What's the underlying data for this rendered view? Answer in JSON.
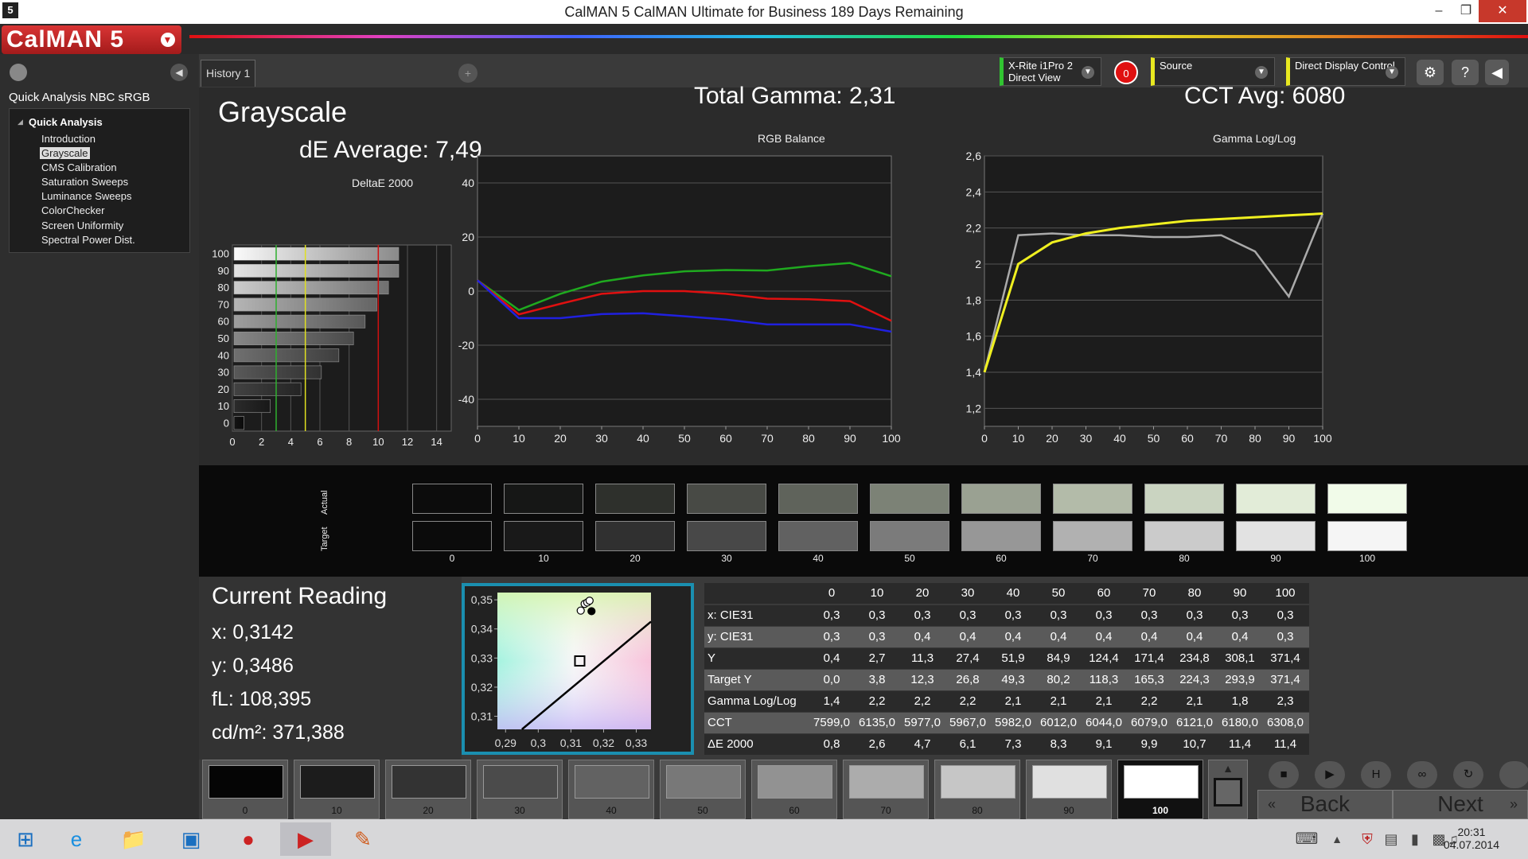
{
  "window": {
    "title": "CalMAN 5 CalMAN Ultimate for Business 189 Days Remaining",
    "app_icon": "5"
  },
  "header": {
    "logo": "CalMAN 5"
  },
  "sidebar": {
    "workflow_title": "Quick Analysis NBC sRGB",
    "root": "Quick Analysis",
    "items": [
      {
        "label": "Introduction"
      },
      {
        "label": "Grayscale",
        "selected": true
      },
      {
        "label": "CMS Calibration"
      },
      {
        "label": "Saturation Sweeps"
      },
      {
        "label": "Luminance Sweeps"
      },
      {
        "label": "ColorChecker"
      },
      {
        "label": "Screen Uniformity"
      },
      {
        "label": "Spectral Power Dist."
      }
    ]
  },
  "tabs": [
    {
      "label": "History 1"
    }
  ],
  "devices": {
    "meter_line1": "X-Rite i1Pro 2",
    "meter_line2": "Direct View",
    "meter_count": "0",
    "source": "Source",
    "display": "Direct Display Control"
  },
  "main": {
    "page_title": "Grayscale",
    "de_average": "dE Average: 7,49",
    "total_gamma": "Total Gamma: 2,31",
    "cct_avg": "CCT Avg: 6080"
  },
  "colors": {
    "accent_red": "#e01010",
    "cie_frame": "#1a8fb0"
  },
  "chart_data": [
    {
      "type": "bar",
      "title": "DeltaE 2000",
      "categories": [
        "100",
        "90",
        "80",
        "70",
        "60",
        "50",
        "40",
        "30",
        "20",
        "10",
        "0"
      ],
      "values": [
        11.4,
        11.4,
        10.7,
        9.9,
        9.1,
        8.3,
        7.3,
        6.1,
        4.7,
        2.6,
        0.8
      ],
      "xlim": [
        0,
        15
      ],
      "x_ticks": [
        "0",
        "2",
        "4",
        "6",
        "8",
        "10",
        "12",
        "14"
      ],
      "threshold_lines": [
        {
          "x": 3,
          "color": "#2fb02f"
        },
        {
          "x": 5,
          "color": "#e0e020"
        },
        {
          "x": 10,
          "color": "#d01010"
        }
      ]
    },
    {
      "type": "line",
      "title": "RGB Balance",
      "x": [
        0,
        10,
        20,
        30,
        40,
        50,
        60,
        70,
        80,
        90,
        100
      ],
      "x_ticks": [
        "0",
        "10",
        "20",
        "30",
        "40",
        "50",
        "60",
        "70",
        "80",
        "90",
        "100"
      ],
      "y_ticks": [
        "40",
        "20",
        "0",
        "-20",
        "-40"
      ],
      "ylim": [
        -50,
        50
      ],
      "series": [
        {
          "color": "#1faa1f",
          "values": [
            4,
            -7,
            -1,
            3.5,
            5.8,
            7.3,
            7.8,
            7.6,
            9.2,
            10.4,
            5.5
          ]
        },
        {
          "color": "#e01010",
          "values": [
            4,
            -8.6,
            -4.7,
            -1,
            0,
            0,
            -1,
            -2.8,
            -3,
            -3.7,
            -11
          ]
        },
        {
          "color": "#2020e0",
          "values": [
            4,
            -10,
            -10,
            -8.5,
            -8.2,
            -9.3,
            -10.5,
            -12.3,
            -12.3,
            -12.3,
            -15
          ]
        }
      ]
    },
    {
      "type": "line",
      "title": "Gamma Log/Log",
      "x": [
        0,
        10,
        20,
        30,
        40,
        50,
        60,
        70,
        80,
        90,
        100
      ],
      "x_ticks": [
        "0",
        "10",
        "20",
        "30",
        "40",
        "50",
        "60",
        "70",
        "80",
        "90",
        "100"
      ],
      "y_ticks": [
        "2,6",
        "2,4",
        "2,2",
        "2",
        "1,8",
        "1,6",
        "1,4",
        "1,2"
      ],
      "ylim": [
        1.1,
        2.6
      ],
      "series": [
        {
          "color": "#aaaaaa",
          "values": [
            1.4,
            2.16,
            2.17,
            2.16,
            2.16,
            2.15,
            2.15,
            2.16,
            2.07,
            1.82,
            2.28
          ]
        },
        {
          "color": "#f0f020",
          "values": [
            1.4,
            2.0,
            2.12,
            2.17,
            2.2,
            2.22,
            2.24,
            2.25,
            2.26,
            2.27,
            2.28
          ]
        }
      ]
    },
    {
      "type": "scatter",
      "title": "",
      "x_ticks": [
        "0,29",
        "0,3",
        "0,31",
        "0,32",
        "0,33"
      ],
      "y_ticks": [
        "0,35",
        "0,34",
        "0,33",
        "0,32",
        "0,31"
      ],
      "xlim": [
        0.2875,
        0.3345
      ],
      "ylim": [
        0.3055,
        0.3525
      ],
      "target_point": {
        "x": 0.3127,
        "y": 0.329
      },
      "points": [
        {
          "x": 0.3142,
          "y": 0.3486,
          "style": "hollow"
        },
        {
          "x": 0.315,
          "y": 0.3491,
          "style": "hollow"
        },
        {
          "x": 0.3157,
          "y": 0.3497,
          "style": "hollow"
        },
        {
          "x": 0.313,
          "y": 0.3463,
          "style": "hollow"
        },
        {
          "x": 0.3163,
          "y": 0.3461,
          "style": "filled"
        }
      ],
      "locus": [
        [
          0.295,
          0.3055
        ],
        [
          0.3345,
          0.3425
        ]
      ]
    }
  ],
  "swatches": {
    "row_actual": "Actual",
    "row_target": "Target",
    "labels": [
      "0",
      "10",
      "20",
      "30",
      "40",
      "50",
      "60",
      "70",
      "80",
      "90",
      "100"
    ],
    "actual": [
      "#0c0c0c",
      "#161716",
      "#2e302c",
      "#484a45",
      "#5f635b",
      "#7c8276",
      "#9aa192",
      "#b3bba9",
      "#cad4c1",
      "#e2ecd8",
      "#f1fbe9"
    ],
    "target": [
      "#0b0b0b",
      "#191919",
      "#303030",
      "#484848",
      "#616161",
      "#7b7b7b",
      "#979797",
      "#b1b1b1",
      "#cbcbcb",
      "#e2e2e2",
      "#f5f5f5"
    ]
  },
  "reading": {
    "title": "Current Reading",
    "x": "x: 0,3142",
    "y": "y: 0,3486",
    "fl": "fL: 108,395",
    "cdm2": "cd/m²: 371,388"
  },
  "table": {
    "columns": [
      "0",
      "10",
      "20",
      "30",
      "40",
      "50",
      "60",
      "70",
      "80",
      "90",
      "100"
    ],
    "rows": [
      {
        "label": "x: CIE31",
        "values": [
          "0,3",
          "0,3",
          "0,3",
          "0,3",
          "0,3",
          "0,3",
          "0,3",
          "0,3",
          "0,3",
          "0,3",
          "0,3"
        ]
      },
      {
        "label": "y: CIE31",
        "values": [
          "0,3",
          "0,3",
          "0,4",
          "0,4",
          "0,4",
          "0,4",
          "0,4",
          "0,4",
          "0,4",
          "0,4",
          "0,3"
        ]
      },
      {
        "label": "Y",
        "values": [
          "0,4",
          "2,7",
          "11,3",
          "27,4",
          "51,9",
          "84,9",
          "124,4",
          "171,4",
          "234,8",
          "308,1",
          "371,4"
        ]
      },
      {
        "label": "Target Y",
        "values": [
          "0,0",
          "3,8",
          "12,3",
          "26,8",
          "49,3",
          "80,2",
          "118,3",
          "165,3",
          "224,3",
          "293,9",
          "371,4"
        ]
      },
      {
        "label": "Gamma Log/Log",
        "values": [
          "1,4",
          "2,2",
          "2,2",
          "2,2",
          "2,1",
          "2,1",
          "2,1",
          "2,2",
          "2,1",
          "1,8",
          "2,3"
        ]
      },
      {
        "label": "CCT",
        "values": [
          "7599,0",
          "6135,0",
          "5977,0",
          "5967,0",
          "5982,0",
          "6012,0",
          "6044,0",
          "6079,0",
          "6121,0",
          "6180,0",
          "6308,0"
        ]
      },
      {
        "label": "ΔE 2000",
        "values": [
          "0,8",
          "2,6",
          "4,7",
          "6,1",
          "7,3",
          "8,3",
          "9,1",
          "9,9",
          "10,7",
          "11,4",
          "11,4"
        ]
      }
    ]
  },
  "bottom": {
    "patches": [
      {
        "label": "0",
        "color": "#050505"
      },
      {
        "label": "10",
        "color": "#1c1c1c"
      },
      {
        "label": "20",
        "color": "#333333"
      },
      {
        "label": "30",
        "color": "#4b4b4b"
      },
      {
        "label": "40",
        "color": "#626262"
      },
      {
        "label": "50",
        "color": "#787878"
      },
      {
        "label": "60",
        "color": "#929292"
      },
      {
        "label": "70",
        "color": "#acacac"
      },
      {
        "label": "80",
        "color": "#c6c6c6"
      },
      {
        "label": "90",
        "color": "#e0e0e0"
      },
      {
        "label": "100",
        "color": "#ffffff",
        "selected": true
      }
    ],
    "back_label": "Back",
    "next_label": "Next"
  },
  "taskbar": {
    "time": "20:31",
    "date": "04.07.2014"
  }
}
